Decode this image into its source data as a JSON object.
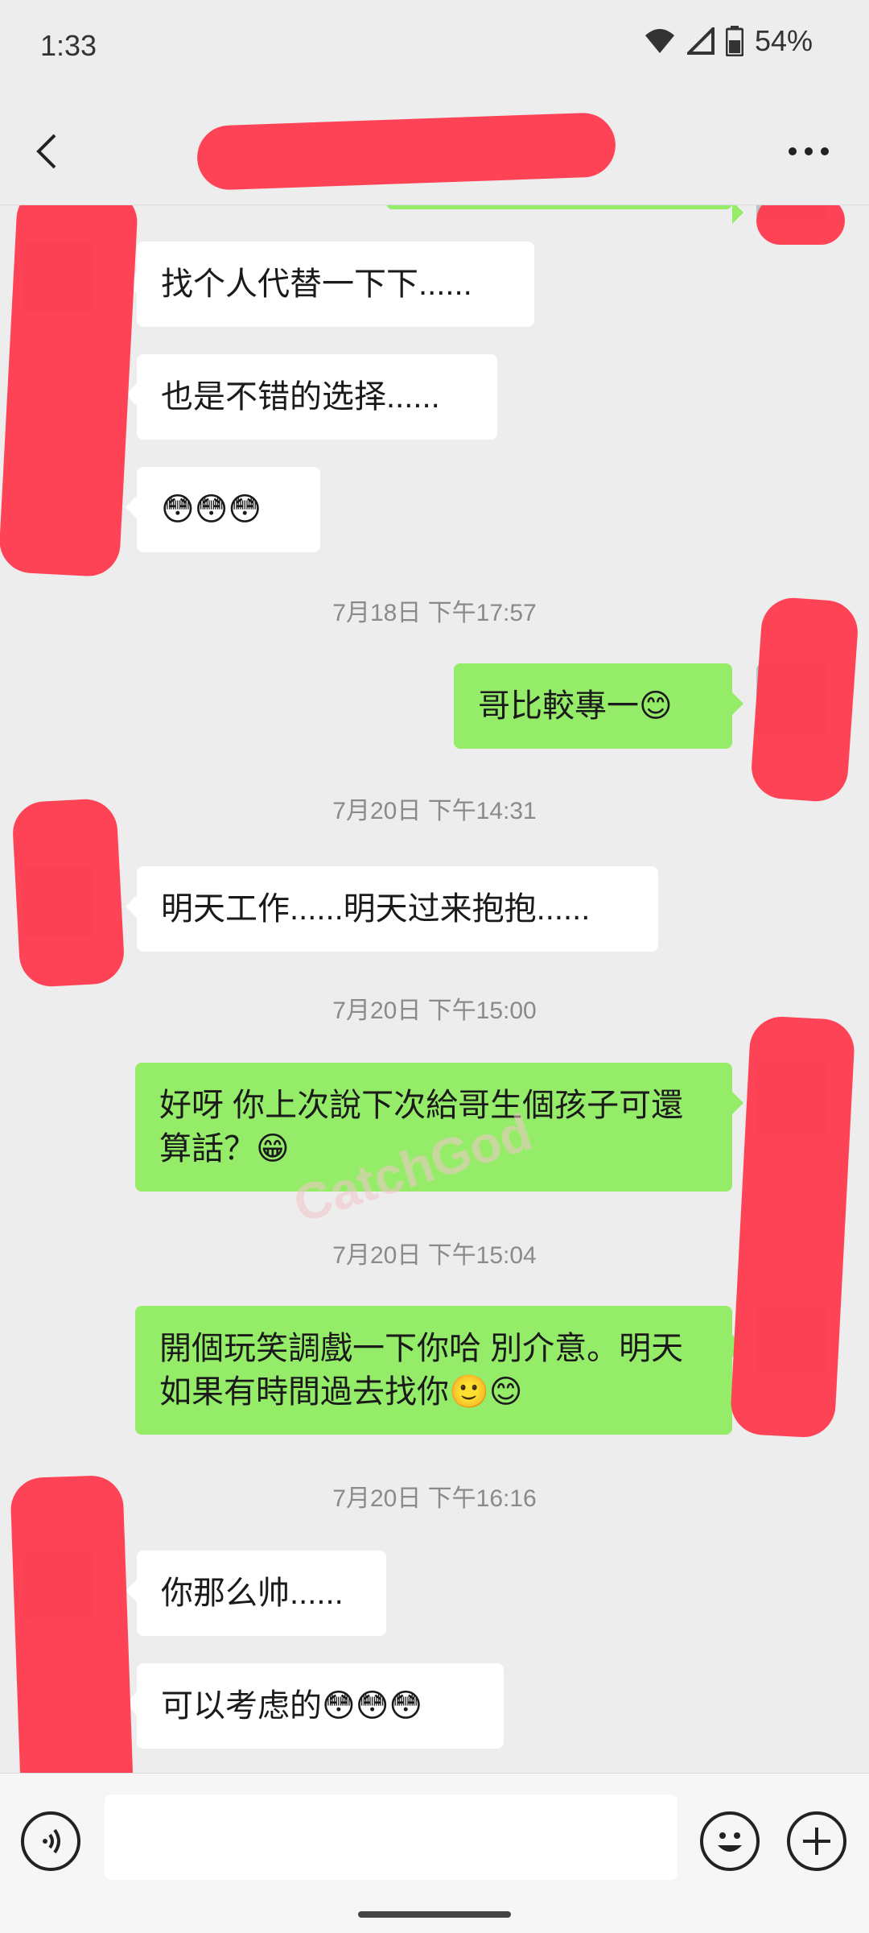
{
  "status": {
    "time": "1:33",
    "battery": "54%"
  },
  "header": {
    "title": ""
  },
  "messages": [
    {
      "type": "in",
      "text": "找个人代替一下下......"
    },
    {
      "type": "in",
      "text": "也是不错的选择......"
    },
    {
      "type": "in",
      "text": "😳😳😳"
    },
    {
      "type": "time",
      "text": "7月18日 下午17:57"
    },
    {
      "type": "out",
      "text": "哥比較專一😊"
    },
    {
      "type": "time",
      "text": "7月20日 下午14:31"
    },
    {
      "type": "in",
      "text": "明天工作......明天过来抱抱......"
    },
    {
      "type": "time",
      "text": "7月20日 下午15:00"
    },
    {
      "type": "out",
      "text": "好呀 你上次說下次給哥生個孩子可還算話？😁"
    },
    {
      "type": "time",
      "text": "7月20日 下午15:04"
    },
    {
      "type": "out",
      "text": "開個玩笑調戲一下你哈 別介意。明天如果有時間過去找你🙂😊"
    },
    {
      "type": "time",
      "text": "7月20日 下午16:16"
    },
    {
      "type": "in",
      "text": "你那么帅......"
    },
    {
      "type": "in",
      "text": "可以考虑的😳😳😳"
    }
  ],
  "watermark": "CatchGod",
  "icons": {
    "back": "chevron-left-icon",
    "more": "more-dots-icon",
    "voice": "voice-icon",
    "emoji": "emoji-icon",
    "plus": "plus-icon",
    "wifi": "wifi-icon",
    "signal": "signal-icon",
    "battery": "battery-icon"
  }
}
